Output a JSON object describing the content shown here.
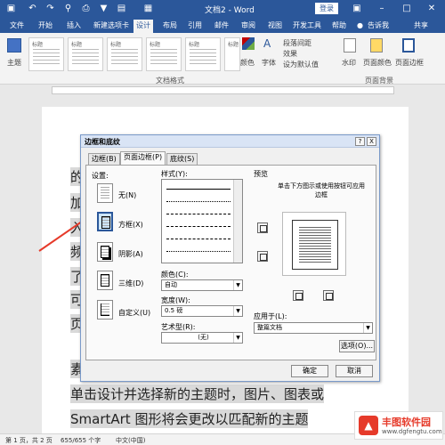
{
  "app": {
    "doc_title": "文档2 - Word",
    "login_label": "登录"
  },
  "tabs": [
    {
      "label": "文件"
    },
    {
      "label": "开始"
    },
    {
      "label": "插入"
    },
    {
      "label": "新建选项卡"
    },
    {
      "label": "设计"
    },
    {
      "label": "布局"
    },
    {
      "label": "引用"
    },
    {
      "label": "邮件"
    },
    {
      "label": "审阅"
    },
    {
      "label": "视图"
    },
    {
      "label": "开发工具"
    },
    {
      "label": "帮助"
    },
    {
      "label": "告诉我"
    },
    {
      "label": "共享"
    }
  ],
  "ribbon": {
    "theme_label": "主题",
    "gallery": [
      {
        "title": "标题"
      },
      {
        "title": "标题"
      },
      {
        "title": "标题"
      },
      {
        "title": "标题"
      },
      {
        "title": "标题"
      },
      {
        "title": "标题"
      }
    ],
    "colors_label": "颜色",
    "fonts_label": "字体",
    "para_spacing_label": "段落间距",
    "effects_label": "效果",
    "set_default_label": "设为默认值",
    "watermark_label": "水印",
    "page_color_label": "页面颜色",
    "page_border_label": "页面边框",
    "doc_format_group": "文档格式",
    "page_bg_group": "页面背景"
  },
  "document": {
    "chars": [
      "的",
      "加",
      "入",
      "频",
      "了",
      "可",
      "页"
    ],
    "line_fragment": "素",
    "line1": "单击设计并选择新的主题时，图片、图表或",
    "line2": "SmartArt 图形将会更改以匹配新的主题"
  },
  "status": {
    "page": "第 1 页，共 2 页",
    "words": "655/655 个字",
    "lang": "中文(中国)"
  },
  "dialog": {
    "title": "边框和底纹",
    "tabs": [
      {
        "label": "边框(B)"
      },
      {
        "label": "页面边框(P)"
      },
      {
        "label": "底纹(S)"
      }
    ],
    "settings_label": "设置:",
    "settings": [
      {
        "label": "无(N)"
      },
      {
        "label": "方框(X)"
      },
      {
        "label": "阴影(A)"
      },
      {
        "label": "三维(D)"
      },
      {
        "label": "自定义(U)"
      }
    ],
    "style_label": "样式(Y):",
    "color_label": "颜色(C):",
    "color_value": "自动",
    "width_label": "宽度(W):",
    "width_value": "0.5 磅",
    "art_label": "艺术型(R):",
    "art_value": "(无)",
    "preview_label": "预览",
    "preview_hint": "单击下方图示或使用按钮可应用边框",
    "apply_label": "应用于(L):",
    "apply_value": "整篇文档",
    "options_label": "选项(O)...",
    "ok_label": "确定",
    "cancel_label": "取消",
    "help_label": "?",
    "close_label": "X"
  },
  "watermark": {
    "name": "丰图软件园",
    "url": "www.dgfengtu.com"
  },
  "colors": {
    "word_blue": "#2b579a",
    "arrow_red": "#e63a2a"
  }
}
